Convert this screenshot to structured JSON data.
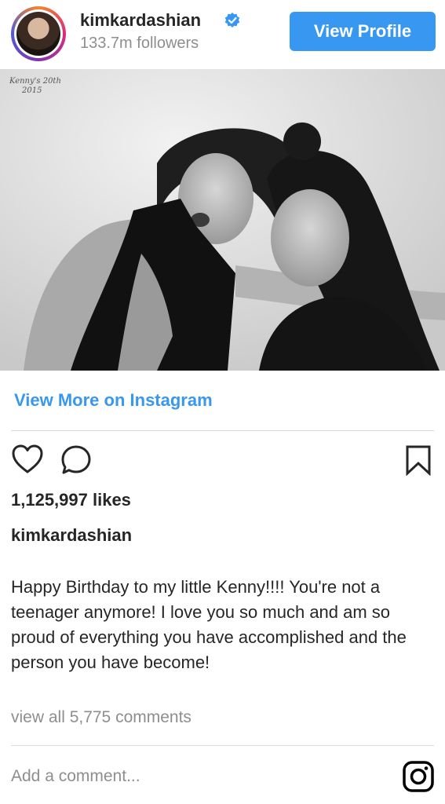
{
  "header": {
    "username": "kimkardashian",
    "followers": "133.7m followers",
    "view_profile_label": "View Profile"
  },
  "photo": {
    "handwriting_line1": "Kenny's 20th",
    "handwriting_line2": "2015"
  },
  "links": {
    "view_more": "View More on Instagram"
  },
  "actions": {
    "like_icon": "heart-icon",
    "comment_icon": "comment-bubble-icon",
    "save_icon": "bookmark-icon"
  },
  "post": {
    "likes": "1,125,997 likes",
    "caption_username": "kimkardashian",
    "caption_text": "Happy Birthday to my little Kenny!!!! You're not a teenager anymore! I love you so much and am so proud of everything you have accomplished and the person you have become!",
    "view_comments": "view all 5,775 comments"
  },
  "footer": {
    "comment_placeholder": "Add a comment...",
    "logo_icon": "instagram-logo-icon"
  },
  "colors": {
    "accent": "#3897f0",
    "text": "#262626",
    "muted": "#8e8e8e",
    "divider": "#dbdbdb"
  }
}
